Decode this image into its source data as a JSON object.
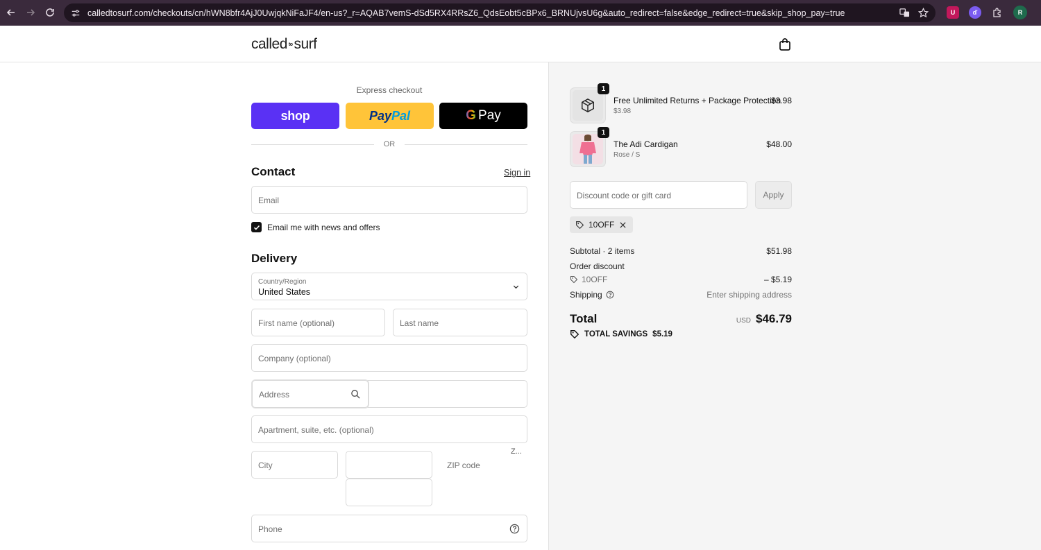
{
  "browser": {
    "url": "calledtosurf.com/checkouts/cn/hWN8bfr4AjJ0UwjqkNiFaJF4/en-us?_r=AQAB7vemS-dSd5RX4RRsZ6_QdsEobt5cBPx6_BRNUjvsU6g&auto_redirect=false&edge_redirect=true&skip_shop_pay=true",
    "profile_initial": "R"
  },
  "store": {
    "logo_left": "called",
    "logo_mid": "to",
    "logo_right": "surf"
  },
  "express": {
    "label": "Express checkout",
    "shop_label": "shop",
    "paypal_a": "Pay",
    "paypal_b": "Pal",
    "gpay_g": "G",
    "gpay_label": "Pay",
    "or": "OR"
  },
  "contact": {
    "title": "Contact",
    "sign_in": "Sign in",
    "email_placeholder": "Email",
    "newsletter_label": "Email me with news and offers"
  },
  "delivery": {
    "title": "Delivery",
    "country_label": "Country/Region",
    "country_value": "United States",
    "first_name": "First name (optional)",
    "last_name": "Last name",
    "company": "Company (optional)",
    "address": "Address",
    "apartment": "Apartment, suite, etc. (optional)",
    "city": "City",
    "zip_truncated": "Z...",
    "zip": "ZIP code",
    "phone": "Phone"
  },
  "cart": {
    "items": [
      {
        "name": "Free Unlimited Returns + Package Protection",
        "sub": "$3.98",
        "price": "$3.98",
        "qty": "1"
      },
      {
        "name": "The Adi Cardigan",
        "sub": "Rose / S",
        "price": "$48.00",
        "qty": "1"
      }
    ],
    "discount_placeholder": "Discount code or gift card",
    "apply": "Apply",
    "applied_code": "10OFF"
  },
  "summary": {
    "subtotal_label": "Subtotal · 2 items",
    "subtotal_value": "$51.98",
    "order_discount_label": "Order discount",
    "discount_code": "10OFF",
    "discount_value": "– $5.19",
    "shipping_label": "Shipping",
    "shipping_value": "Enter shipping address",
    "total_label": "Total",
    "currency": "USD",
    "total_value": "$46.79",
    "savings_label": "TOTAL SAVINGS",
    "savings_value": "$5.19"
  }
}
